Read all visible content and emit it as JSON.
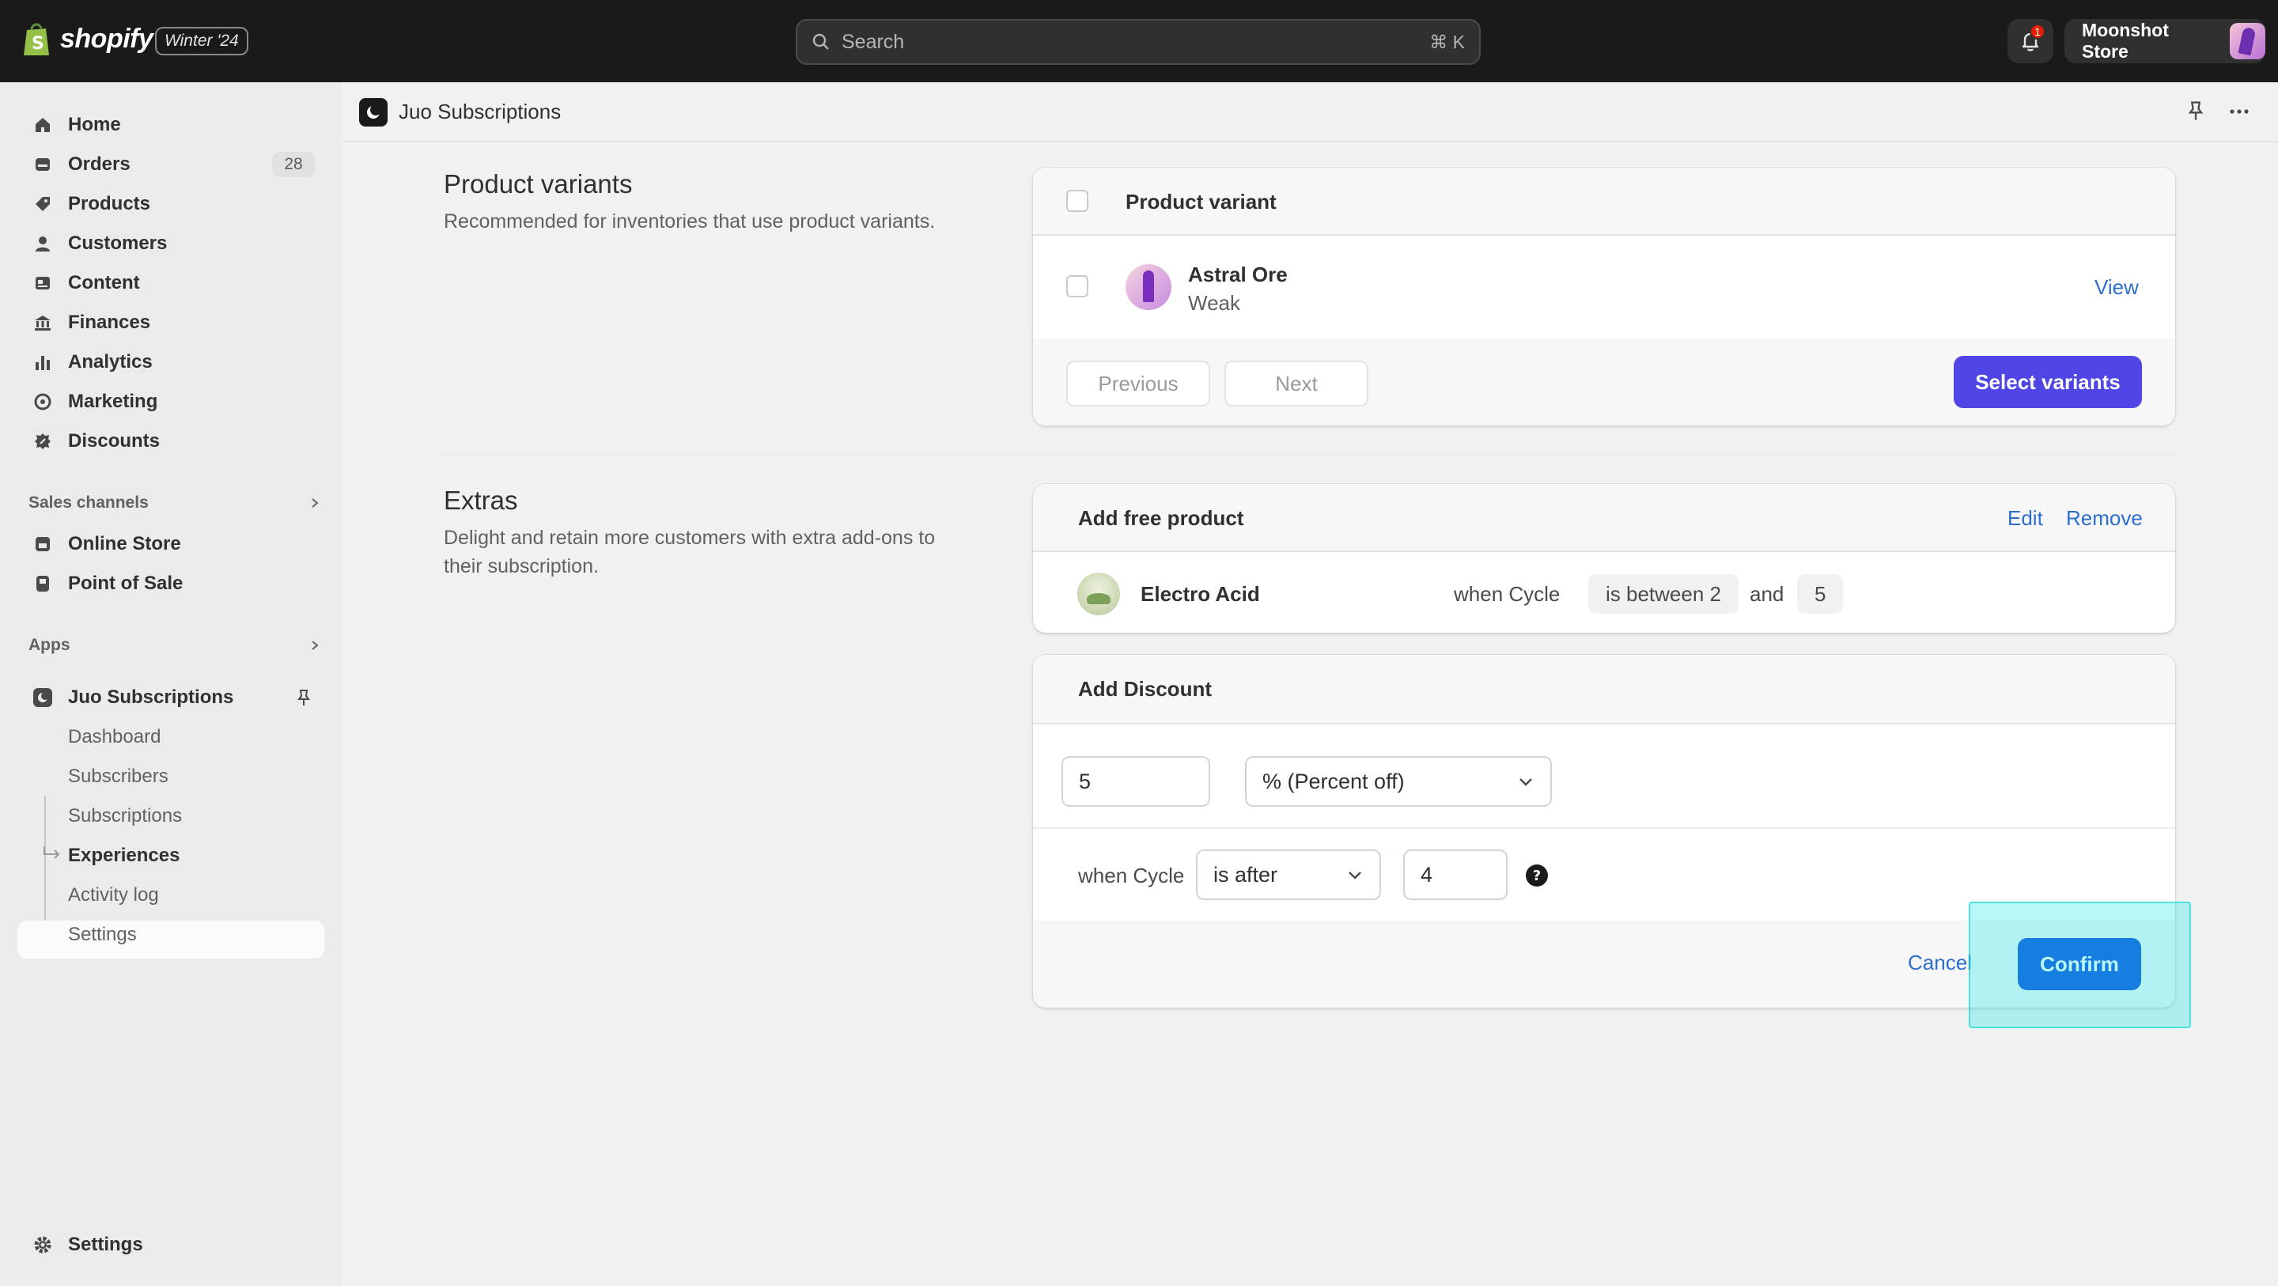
{
  "topbar": {
    "logo_text": "shopify",
    "edition": "Winter '24",
    "search_placeholder": "Search",
    "search_shortcut": "⌘ K",
    "notification_count": "1",
    "store_name": "Moonshot Store"
  },
  "sidebar": {
    "items": [
      {
        "label": "Home",
        "icon": "home-icon"
      },
      {
        "label": "Orders",
        "icon": "orders-icon",
        "badge": "28"
      },
      {
        "label": "Products",
        "icon": "tag-icon"
      },
      {
        "label": "Customers",
        "icon": "person-icon"
      },
      {
        "label": "Content",
        "icon": "content-icon"
      },
      {
        "label": "Finances",
        "icon": "bank-icon"
      },
      {
        "label": "Analytics",
        "icon": "chart-icon"
      },
      {
        "label": "Marketing",
        "icon": "target-icon"
      },
      {
        "label": "Discounts",
        "icon": "discount-icon"
      }
    ],
    "sales_channels_label": "Sales channels",
    "channels": [
      {
        "label": "Online Store",
        "icon": "store-icon"
      },
      {
        "label": "Point of Sale",
        "icon": "pos-icon"
      }
    ],
    "apps_label": "Apps",
    "app_name": "Juo Subscriptions",
    "app_subitems": [
      "Dashboard",
      "Subscribers",
      "Subscriptions",
      "Experiences",
      "Activity log",
      "Settings"
    ],
    "settings_label": "Settings"
  },
  "header": {
    "app_title": "Juo Subscriptions"
  },
  "variants_section": {
    "title": "Product variants",
    "description": "Recommended for inventories that use product variants.",
    "column_header": "Product variant",
    "row": {
      "name": "Astral Ore",
      "variant": "Weak",
      "action": "View"
    },
    "prev_label": "Previous",
    "next_label": "Next",
    "select_label": "Select variants"
  },
  "extras_section": {
    "title": "Extras",
    "description_line1": "Delight and retain more customers with extra add-ons to",
    "description_line2": "their subscription.",
    "free_product": {
      "heading": "Add free product",
      "edit_label": "Edit",
      "remove_label": "Remove",
      "product_name": "Electro Acid",
      "when_text": "when Cycle",
      "condition": "is between 2",
      "and_text": "and",
      "end_value": "5"
    },
    "discount": {
      "heading": "Add Discount",
      "amount": "5",
      "type_selected": "% (Percent off)",
      "when_text": "when Cycle",
      "condition_selected": "is after",
      "cycle_value": "4",
      "cancel_label": "Cancel",
      "confirm_label": "Confirm"
    }
  },
  "colors": {
    "topbar": "#1a1a1a",
    "primary_button": "#4f46e5",
    "confirm_button": "#1f56de",
    "link": "#2c6ecb",
    "highlight": "#00e6e6"
  }
}
